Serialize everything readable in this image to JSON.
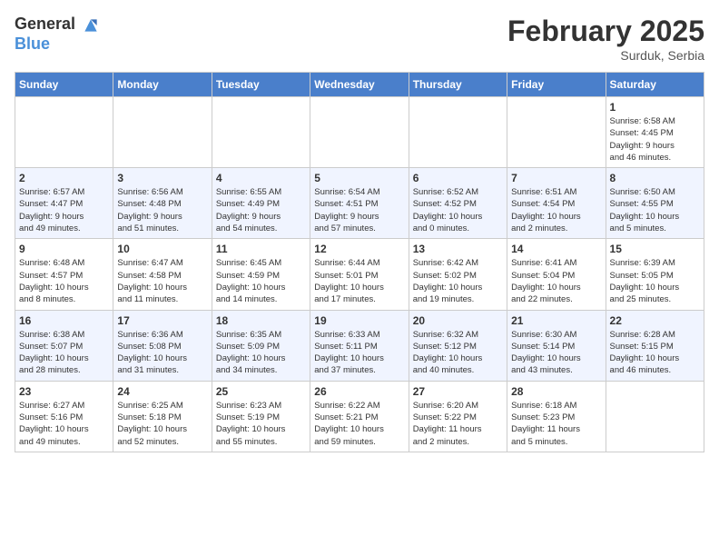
{
  "header": {
    "logo": {
      "general": "General",
      "blue": "Blue"
    },
    "title": "February 2025",
    "location": "Surduk, Serbia"
  },
  "weekdays": [
    "Sunday",
    "Monday",
    "Tuesday",
    "Wednesday",
    "Thursday",
    "Friday",
    "Saturday"
  ],
  "weeks": [
    {
      "days": [
        {
          "number": "",
          "empty": true
        },
        {
          "number": "",
          "empty": true
        },
        {
          "number": "",
          "empty": true
        },
        {
          "number": "",
          "empty": true
        },
        {
          "number": "",
          "empty": true
        },
        {
          "number": "",
          "empty": true
        },
        {
          "number": "1",
          "info": "Sunrise: 6:58 AM\nSunset: 4:45 PM\nDaylight: 9 hours\nand 46 minutes."
        }
      ]
    },
    {
      "days": [
        {
          "number": "2",
          "info": "Sunrise: 6:57 AM\nSunset: 4:47 PM\nDaylight: 9 hours\nand 49 minutes."
        },
        {
          "number": "3",
          "info": "Sunrise: 6:56 AM\nSunset: 4:48 PM\nDaylight: 9 hours\nand 51 minutes."
        },
        {
          "number": "4",
          "info": "Sunrise: 6:55 AM\nSunset: 4:49 PM\nDaylight: 9 hours\nand 54 minutes."
        },
        {
          "number": "5",
          "info": "Sunrise: 6:54 AM\nSunset: 4:51 PM\nDaylight: 9 hours\nand 57 minutes."
        },
        {
          "number": "6",
          "info": "Sunrise: 6:52 AM\nSunset: 4:52 PM\nDaylight: 10 hours\nand 0 minutes."
        },
        {
          "number": "7",
          "info": "Sunrise: 6:51 AM\nSunset: 4:54 PM\nDaylight: 10 hours\nand 2 minutes."
        },
        {
          "number": "8",
          "info": "Sunrise: 6:50 AM\nSunset: 4:55 PM\nDaylight: 10 hours\nand 5 minutes."
        }
      ]
    },
    {
      "days": [
        {
          "number": "9",
          "info": "Sunrise: 6:48 AM\nSunset: 4:57 PM\nDaylight: 10 hours\nand 8 minutes."
        },
        {
          "number": "10",
          "info": "Sunrise: 6:47 AM\nSunset: 4:58 PM\nDaylight: 10 hours\nand 11 minutes."
        },
        {
          "number": "11",
          "info": "Sunrise: 6:45 AM\nSunset: 4:59 PM\nDaylight: 10 hours\nand 14 minutes."
        },
        {
          "number": "12",
          "info": "Sunrise: 6:44 AM\nSunset: 5:01 PM\nDaylight: 10 hours\nand 17 minutes."
        },
        {
          "number": "13",
          "info": "Sunrise: 6:42 AM\nSunset: 5:02 PM\nDaylight: 10 hours\nand 19 minutes."
        },
        {
          "number": "14",
          "info": "Sunrise: 6:41 AM\nSunset: 5:04 PM\nDaylight: 10 hours\nand 22 minutes."
        },
        {
          "number": "15",
          "info": "Sunrise: 6:39 AM\nSunset: 5:05 PM\nDaylight: 10 hours\nand 25 minutes."
        }
      ]
    },
    {
      "days": [
        {
          "number": "16",
          "info": "Sunrise: 6:38 AM\nSunset: 5:07 PM\nDaylight: 10 hours\nand 28 minutes."
        },
        {
          "number": "17",
          "info": "Sunrise: 6:36 AM\nSunset: 5:08 PM\nDaylight: 10 hours\nand 31 minutes."
        },
        {
          "number": "18",
          "info": "Sunrise: 6:35 AM\nSunset: 5:09 PM\nDaylight: 10 hours\nand 34 minutes."
        },
        {
          "number": "19",
          "info": "Sunrise: 6:33 AM\nSunset: 5:11 PM\nDaylight: 10 hours\nand 37 minutes."
        },
        {
          "number": "20",
          "info": "Sunrise: 6:32 AM\nSunset: 5:12 PM\nDaylight: 10 hours\nand 40 minutes."
        },
        {
          "number": "21",
          "info": "Sunrise: 6:30 AM\nSunset: 5:14 PM\nDaylight: 10 hours\nand 43 minutes."
        },
        {
          "number": "22",
          "info": "Sunrise: 6:28 AM\nSunset: 5:15 PM\nDaylight: 10 hours\nand 46 minutes."
        }
      ]
    },
    {
      "days": [
        {
          "number": "23",
          "info": "Sunrise: 6:27 AM\nSunset: 5:16 PM\nDaylight: 10 hours\nand 49 minutes."
        },
        {
          "number": "24",
          "info": "Sunrise: 6:25 AM\nSunset: 5:18 PM\nDaylight: 10 hours\nand 52 minutes."
        },
        {
          "number": "25",
          "info": "Sunrise: 6:23 AM\nSunset: 5:19 PM\nDaylight: 10 hours\nand 55 minutes."
        },
        {
          "number": "26",
          "info": "Sunrise: 6:22 AM\nSunset: 5:21 PM\nDaylight: 10 hours\nand 59 minutes."
        },
        {
          "number": "27",
          "info": "Sunrise: 6:20 AM\nSunset: 5:22 PM\nDaylight: 11 hours\nand 2 minutes."
        },
        {
          "number": "28",
          "info": "Sunrise: 6:18 AM\nSunset: 5:23 PM\nDaylight: 11 hours\nand 5 minutes."
        },
        {
          "number": "",
          "empty": true
        }
      ]
    }
  ]
}
